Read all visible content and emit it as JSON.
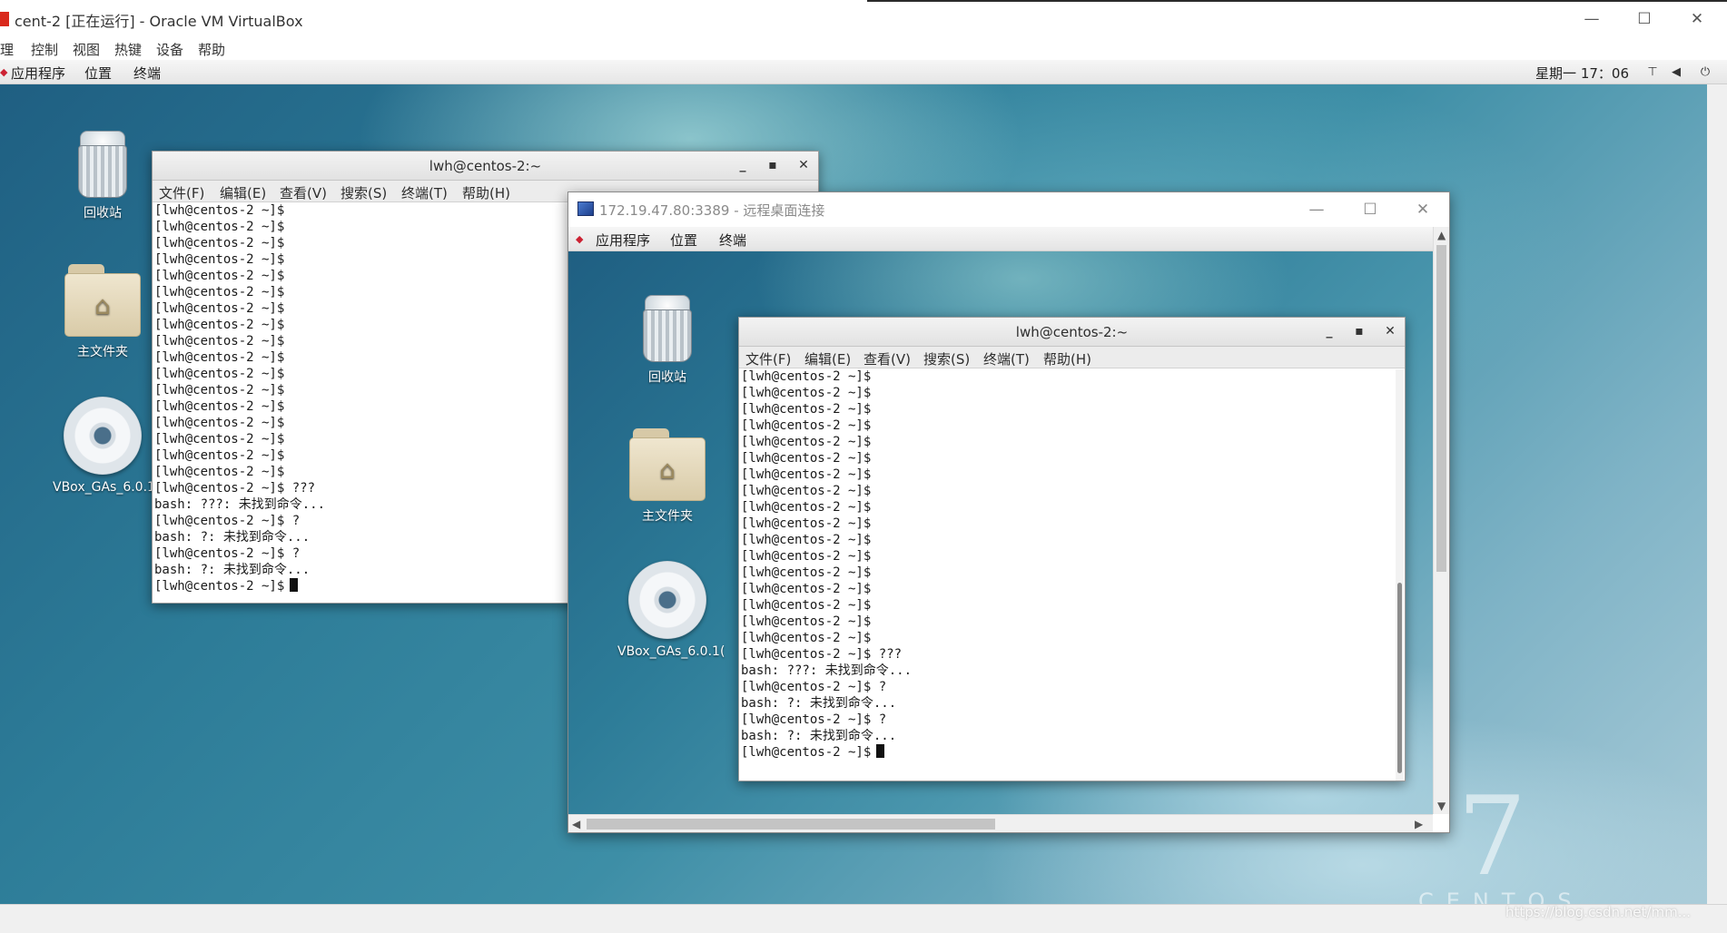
{
  "vbox": {
    "title": "cent-2 [正在运行] - Oracle VM VirtualBox",
    "menu": [
      "理",
      "控制",
      "视图",
      "热键",
      "设备",
      "帮助"
    ],
    "win_controls": {
      "minimize": "—",
      "maximize": "☐",
      "close": "✕"
    }
  },
  "guest_panel": {
    "apps": "应用程序",
    "places": "位置",
    "terminal": "终端",
    "clock": "星期一 17：06",
    "tray_icons": [
      "network-icon",
      "volume-icon",
      "power-icon"
    ]
  },
  "desktop_icons": [
    {
      "name": "trash",
      "label": "回收站"
    },
    {
      "name": "home-folder",
      "label": "主文件夹"
    },
    {
      "name": "vbox-disc",
      "label": "VBox_GAs_6.0.1("
    }
  ],
  "centos_mark": {
    "number": "7",
    "text": "CENTOS"
  },
  "terminal": {
    "title": "lwh@centos-2:~",
    "menu": [
      "文件(F)",
      "编辑(E)",
      "查看(V)",
      "搜索(S)",
      "终端(T)",
      "帮助(H)"
    ],
    "lines": [
      "[lwh@centos-2 ~]$",
      "[lwh@centos-2 ~]$",
      "[lwh@centos-2 ~]$",
      "[lwh@centos-2 ~]$",
      "[lwh@centos-2 ~]$",
      "[lwh@centos-2 ~]$",
      "[lwh@centos-2 ~]$",
      "[lwh@centos-2 ~]$",
      "[lwh@centos-2 ~]$",
      "[lwh@centos-2 ~]$",
      "[lwh@centos-2 ~]$",
      "[lwh@centos-2 ~]$",
      "[lwh@centos-2 ~]$",
      "[lwh@centos-2 ~]$",
      "[lwh@centos-2 ~]$",
      "[lwh@centos-2 ~]$",
      "[lwh@centos-2 ~]$",
      "[lwh@centos-2 ~]$ ???",
      "bash: ???: 未找到命令...",
      "[lwh@centos-2 ~]$ ?",
      "bash: ?: 未找到命令...",
      "[lwh@centos-2 ~]$ ?",
      "bash: ?: 未找到命令..."
    ],
    "prompt": "[lwh@centos-2 ~]$"
  },
  "rdp": {
    "title": "172.19.47.80:3389 - 远程桌面连接"
  },
  "watermark": "https://blog.csdn.net/mm..."
}
